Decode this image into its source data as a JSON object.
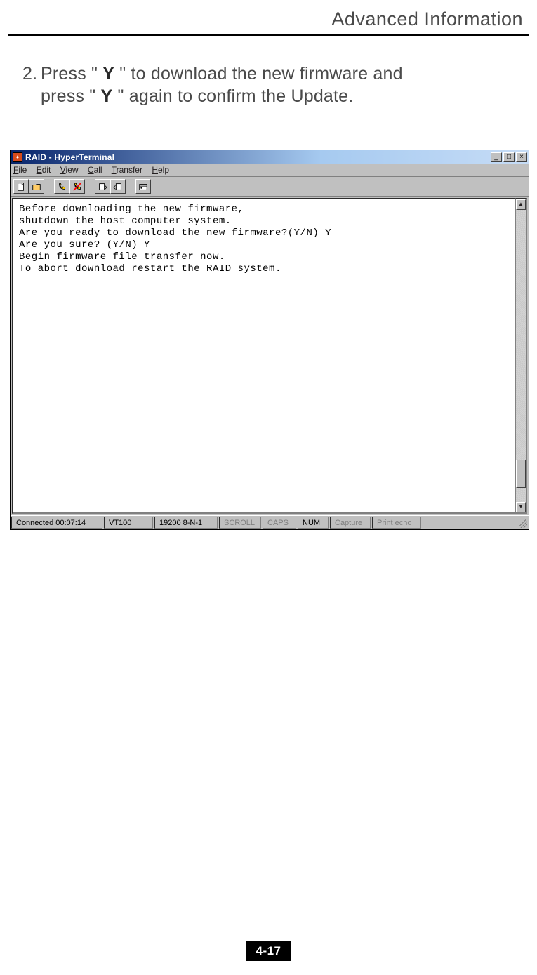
{
  "page": {
    "header_title": "Advanced Information",
    "footer_page": "4-17"
  },
  "instruction": {
    "number": "2.",
    "pre": "Press \" ",
    "key1": "Y",
    "mid1": " \"  to download the new firmware and",
    "line2_pre": "press \" ",
    "key2": "Y",
    "line2_post": " \" again to confirm the Update."
  },
  "window": {
    "title": "RAID - HyperTerminal",
    "menus": [
      "File",
      "Edit",
      "View",
      "Call",
      "Transfer",
      "Help"
    ],
    "terminal_text": "Before downloading the new firmware,\nshutdown the host computer system.\nAre you ready to download the new firmware?(Y/N) Y\nAre you sure? (Y/N) Y\nBegin firmware file transfer now.\nTo abort download restart the RAID system.",
    "status": {
      "connected": "Connected 00:07:14",
      "emulation": "VT100",
      "params": "19200 8-N-1",
      "scroll": "SCROLL",
      "caps": "CAPS",
      "num": "NUM",
      "capture": "Capture",
      "printecho": "Print echo"
    }
  }
}
